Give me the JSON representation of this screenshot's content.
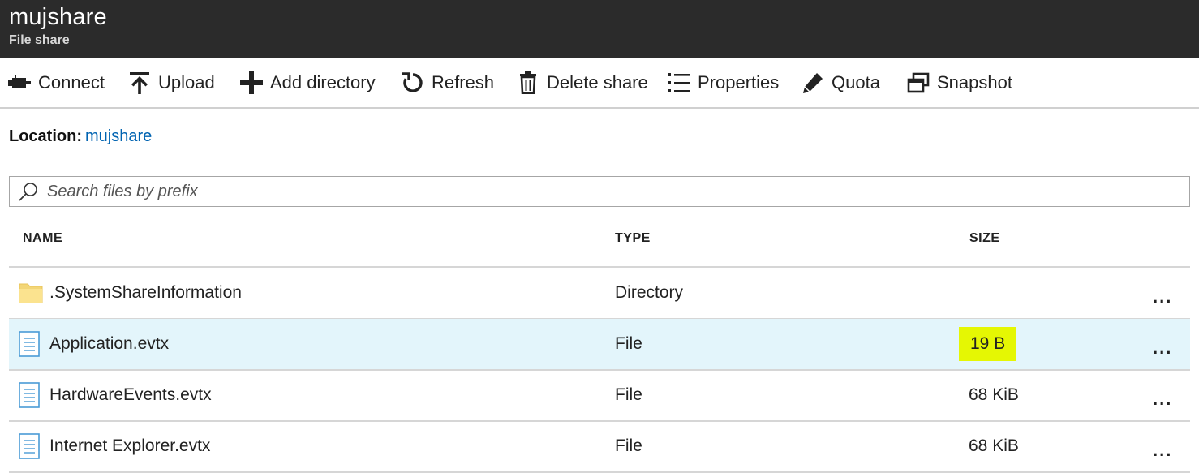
{
  "header": {
    "title": "mujshare",
    "subtitle": "File share"
  },
  "toolbar": {
    "buttons": [
      {
        "label": "Connect",
        "icon": "connect-icon"
      },
      {
        "label": "Upload",
        "icon": "upload-icon"
      },
      {
        "label": "Add directory",
        "icon": "plus-icon"
      },
      {
        "label": "Refresh",
        "icon": "refresh-icon"
      },
      {
        "label": "Delete share",
        "icon": "trash-icon"
      },
      {
        "label": "Properties",
        "icon": "list-icon"
      },
      {
        "label": "Quota",
        "icon": "pencil-icon"
      },
      {
        "label": "Snapshot",
        "icon": "snapshot-icon"
      }
    ]
  },
  "location": {
    "label": "Location:",
    "value": "mujshare"
  },
  "search": {
    "placeholder": "Search files by prefix",
    "value": ""
  },
  "table": {
    "columns": [
      "NAME",
      "TYPE",
      "SIZE"
    ],
    "rows": [
      {
        "name": ".SystemShareInformation",
        "type": "Directory",
        "size": "",
        "icon": "folder-icon",
        "more": "..."
      },
      {
        "name": "Application.evtx",
        "type": "File",
        "size": "19 B",
        "icon": "file-icon",
        "more": "...",
        "selected": true,
        "highlight_color": "#e5f703"
      },
      {
        "name": "HardwareEvents.evtx",
        "type": "File",
        "size": "68 KiB",
        "icon": "file-icon",
        "more": "..."
      },
      {
        "name": "Internet Explorer.evtx",
        "type": "File",
        "size": "68 KiB",
        "icon": "file-icon",
        "more": "..."
      }
    ]
  },
  "colors": {
    "header_bg": "#2b2b2b",
    "link": "#0063b1",
    "selected_row": "#e3f5fb",
    "highlight": "#e5f703"
  }
}
